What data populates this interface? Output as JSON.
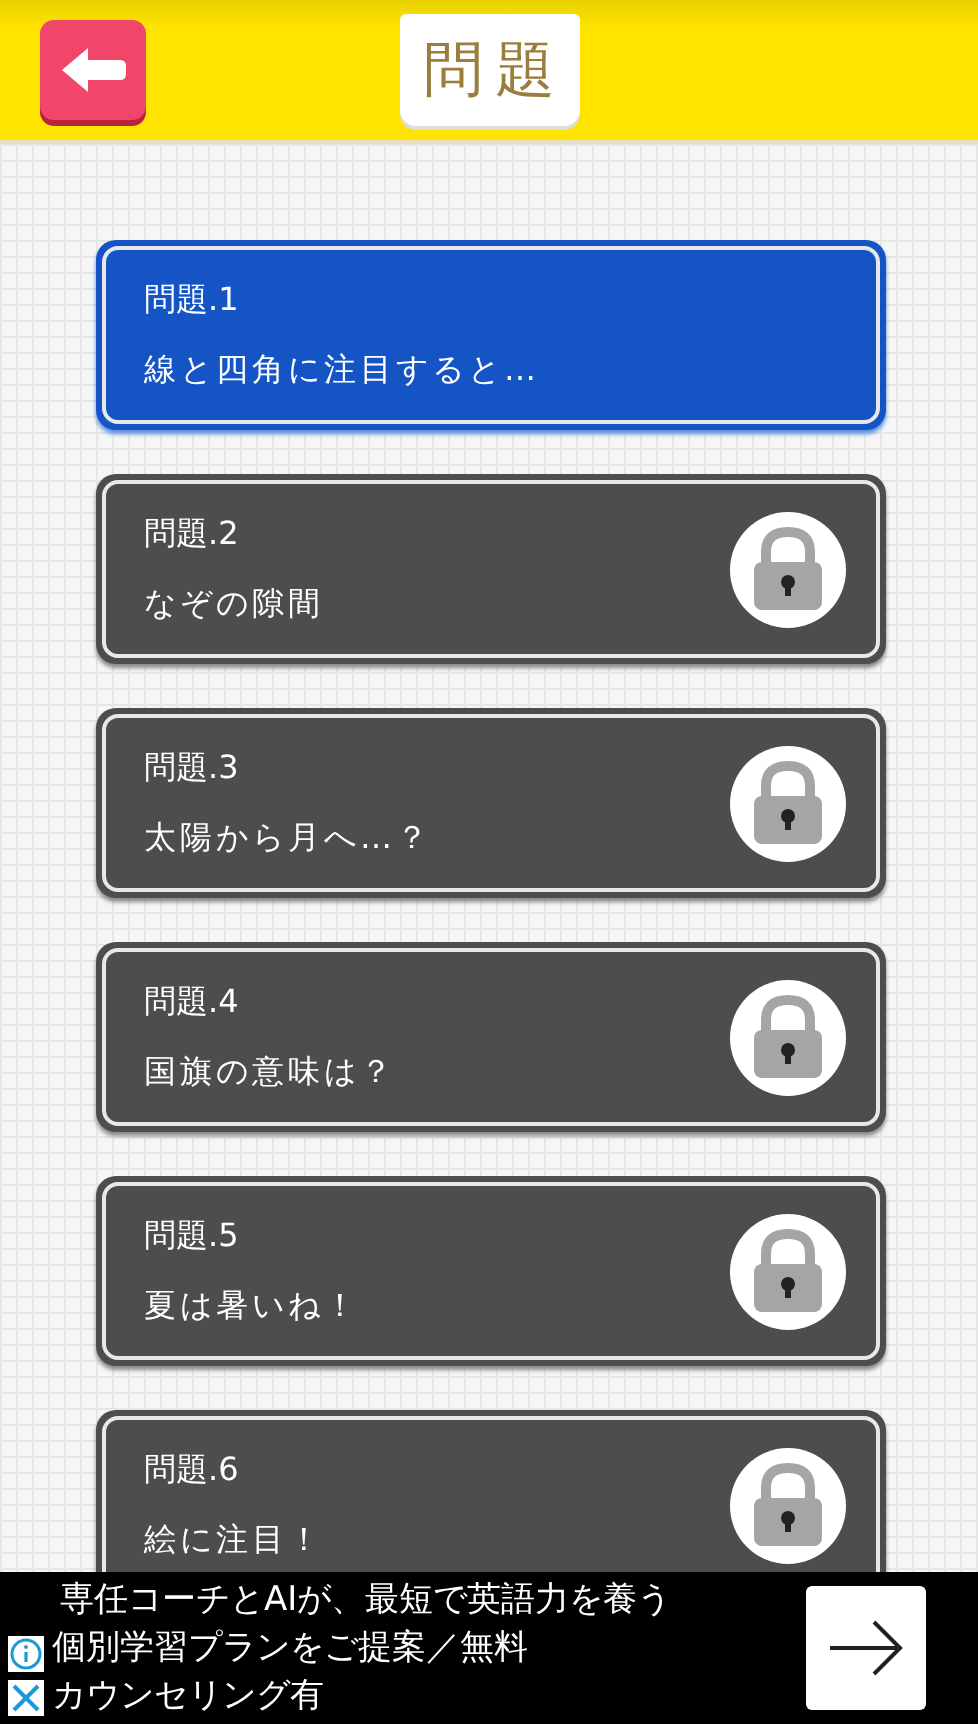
{
  "header": {
    "title": "問題"
  },
  "problems": [
    {
      "number": "問題.1",
      "title": "線と四角に注目すると…",
      "locked": false
    },
    {
      "number": "問題.2",
      "title": "なぞの隙間",
      "locked": true
    },
    {
      "number": "問題.3",
      "title": "太陽から月へ…？",
      "locked": true
    },
    {
      "number": "問題.4",
      "title": "国旗の意味は？",
      "locked": true
    },
    {
      "number": "問題.5",
      "title": "夏は暑いね！",
      "locked": true
    },
    {
      "number": "問題.6",
      "title": "絵に注目！",
      "locked": true
    }
  ],
  "ad": {
    "lines": [
      "専任コーチとAIが、最短で英語力を養う",
      "個別学習プランをご提案／無料",
      "カウンセリング有"
    ]
  }
}
